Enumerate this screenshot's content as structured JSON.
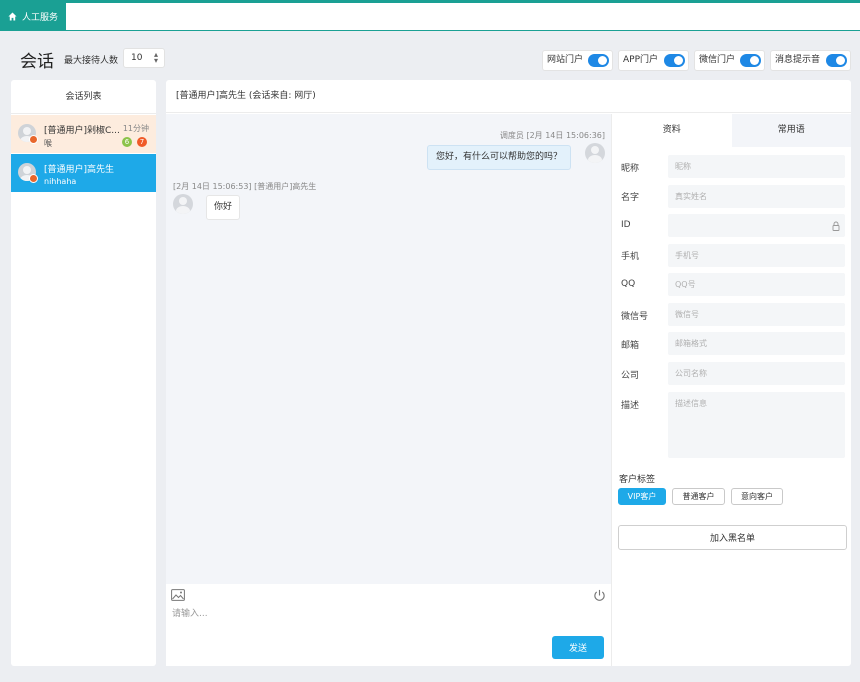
{
  "tab": {
    "label": "人工服务"
  },
  "header": {
    "title": "会话",
    "max_label": "最大接待人数",
    "max_value": "10",
    "portals": [
      {
        "label": "网站门户",
        "on": true
      },
      {
        "label": "APP门户",
        "on": true
      },
      {
        "label": "微信门户",
        "on": true
      },
      {
        "label": "消息提示音",
        "on": true
      }
    ]
  },
  "sidebar": {
    "title": "会话列表",
    "items": [
      {
        "name": "[普通用户]剁椒C...",
        "message": "喉",
        "time": "11分钟",
        "badge_green": "6",
        "badge_red": "7"
      },
      {
        "name": "[普通用户]高先生",
        "message": "nihhaha"
      }
    ]
  },
  "chat": {
    "header": "[普通用户]高先生 (会话来自: 网厅)",
    "messages": [
      {
        "meta": "调度员 [2月 14日 15:06:36]",
        "text": "您好，有什么可以帮助您的吗？"
      },
      {
        "meta": "[2月 14日 15:06:53] [普通用户]高先生",
        "text": "你好"
      }
    ],
    "input_placeholder": "请输入...",
    "send_label": "发送"
  },
  "info": {
    "tabs": [
      "资料",
      "常用语"
    ],
    "fields": [
      {
        "label": "昵称",
        "placeholder": "昵称"
      },
      {
        "label": "名字",
        "placeholder": "真实姓名"
      },
      {
        "label": "ID",
        "placeholder": ""
      },
      {
        "label": "手机",
        "placeholder": "手机号"
      },
      {
        "label": "QQ",
        "placeholder": "QQ号"
      },
      {
        "label": "微信号",
        "placeholder": "微信号"
      },
      {
        "label": "邮箱",
        "placeholder": "邮箱格式"
      },
      {
        "label": "公司",
        "placeholder": "公司名称"
      },
      {
        "label": "描述",
        "placeholder": "描述信息"
      }
    ],
    "tags_label": "客户标签",
    "tags": [
      "VIP客户",
      "普通客户",
      "意向客户"
    ],
    "blacklist_label": "加入黑名单"
  },
  "colors": {
    "accent": "#1ea9e8",
    "topbar": "#1aa094",
    "switch": "#1e88e5"
  }
}
